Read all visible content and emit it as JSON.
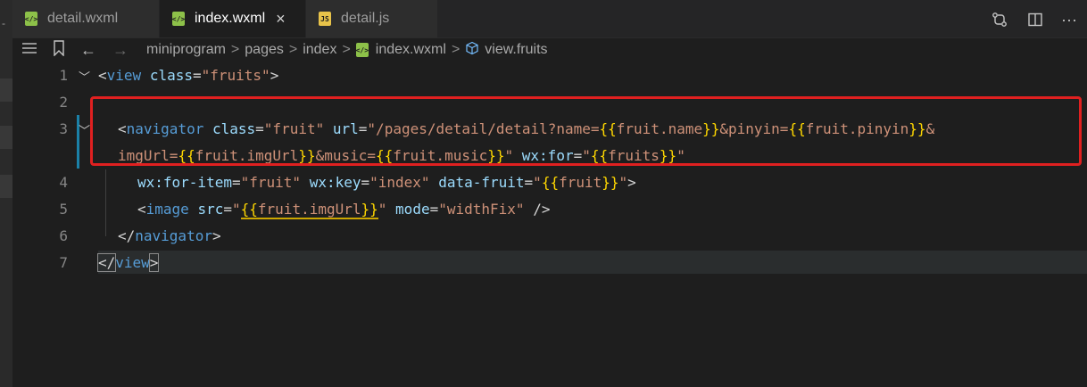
{
  "tabs": [
    {
      "label": "detail.wxml",
      "icon": "wxml-file-icon",
      "active": false
    },
    {
      "label": "index.wxml",
      "icon": "wxml-file-icon",
      "active": true,
      "close": "×"
    },
    {
      "label": "detail.js",
      "icon": "js-file-icon",
      "active": false,
      "icon_text": "JS"
    }
  ],
  "toolbar": {
    "compare_icon": "compare-changes-icon",
    "split_icon": "split-editor-icon",
    "more_icon": "more-actions-icon",
    "more_glyph": "···"
  },
  "breadcrumb": {
    "items": [
      "miniprogram",
      "pages",
      "index",
      "index.wxml",
      "view.fruits"
    ],
    "separator": ">"
  },
  "editor": {
    "line_numbers": [
      "1",
      "2",
      "3",
      "",
      "4",
      "5",
      "6",
      "7"
    ],
    "lines": {
      "l1": {
        "lt": "<",
        "tag": "view",
        "attr": "class",
        "eq": "=",
        "str": "\"fruits\"",
        "gt": ">"
      },
      "l3a": {
        "lt": "<",
        "tag": "navigator",
        "attr1": "class",
        "str1": "\"fruit\"",
        "attr2": "url",
        "str2a": "\"/pages/detail/detail?name=",
        "b1o": "{{",
        "e1": "fruit.name",
        "b1c": "}}",
        "str2b": "&pinyin=",
        "b2o": "{{",
        "e2": "fruit.pinyin",
        "b2c": "}}",
        "str2c": "&"
      },
      "l3b": {
        "str3a": "imgUrl=",
        "b3o": "{{",
        "e3": "fruit.imgUrl",
        "b3c": "}}",
        "str3b": "&music=",
        "b4o": "{{",
        "e4": "fruit.music",
        "b4c": "}}",
        "str3c": "\"",
        "attr3": "wx:for",
        "str4a": "\"",
        "b5o": "{{",
        "e5": "fruits",
        "b5c": "}}",
        "str4b": "\""
      },
      "l4": {
        "attr1": "wx:for-item",
        "str1": "\"fruit\"",
        "attr2": "wx:key",
        "str2": "\"index\"",
        "attr3": "data-fruit",
        "str3a": "\"",
        "b1o": "{{",
        "e1": "fruit",
        "b1c": "}}",
        "str3b": "\"",
        "gt": ">"
      },
      "l5": {
        "lt": "<",
        "tag": "image",
        "attr1": "src",
        "str1a": "\"",
        "b1o": "{{",
        "e1": "fruit.imgUrl",
        "b1c": "}}",
        "str1b": "\"",
        "attr2": "mode",
        "str2": "\"widthFix\"",
        "end": "/>"
      },
      "l6": {
        "lt": "</",
        "tag": "navigator",
        "gt": ">"
      },
      "l7": {
        "lt": "</",
        "tag": "view",
        "gt": ">"
      }
    }
  },
  "colors": {
    "highlight_border": "#e02020",
    "tag": "#569cd6",
    "attribute": "#9cdcfe",
    "string": "#ce9178",
    "brace": "#ffd700",
    "expression": "#da70d6"
  }
}
